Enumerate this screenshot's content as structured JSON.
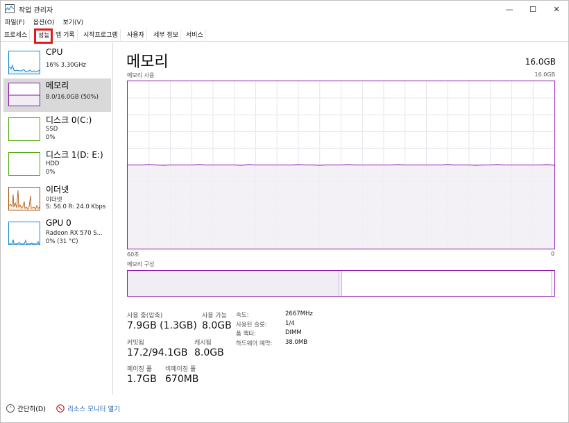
{
  "window": {
    "title": "작업 관리자",
    "minimize_glyph": "—",
    "maximize_glyph": "☐",
    "close_glyph": "✕"
  },
  "menu": [
    "파일(F)",
    "옵션(O)",
    "보기(V)"
  ],
  "tabs": [
    {
      "label": "프로세스",
      "active": false
    },
    {
      "label": "성능",
      "active": true
    },
    {
      "label": "앱 기록",
      "active": false
    },
    {
      "label": "시작프로그램",
      "active": false
    },
    {
      "label": "사용자",
      "active": false
    },
    {
      "label": "세부 정보",
      "active": false
    },
    {
      "label": "서비스",
      "active": false
    }
  ],
  "sidebar": {
    "items": [
      {
        "name": "CPU",
        "line1": "16% 3.30GHz",
        "line2": "",
        "color": "#1784c9",
        "selected": false
      },
      {
        "name": "메모리",
        "line1": "8.0/16.0GB (50%)",
        "line2": "",
        "color": "#8b12ae",
        "selected": true
      },
      {
        "name": "디스크 0(C:)",
        "line1": "SSD",
        "line2": "0%",
        "color": "#4da60c",
        "selected": false
      },
      {
        "name": "디스크 1(D: E:)",
        "line1": "HDD",
        "line2": "0%",
        "color": "#4da60c",
        "selected": false
      },
      {
        "name": "이더넷",
        "line1": "이더넷",
        "line2": "S: 56.0  R: 24.0 Kbps",
        "color": "#a74f01",
        "selected": false
      },
      {
        "name": "GPU 0",
        "line1": "Radeon RX 570 S...",
        "line2": "0% (31 °C)",
        "color": "#1784c9",
        "selected": false
      }
    ]
  },
  "main": {
    "title": "메모리",
    "total": "16.0GB",
    "usage_label": "메모리 사용",
    "usage_max": "16.0GB",
    "time_left": "60초",
    "time_right": "0",
    "composition_label": "메모리 구성",
    "usage_fraction": 0.5,
    "composition": {
      "in_use_fraction": 0.495,
      "modified_fraction": 0.005,
      "standby_fraction": 0.495
    },
    "accent": "#8b12ae",
    "fill": "#f1edf4"
  },
  "stats": {
    "in_use_label": "사용 중(압축)",
    "in_use_value": "7.9GB (1.3GB)",
    "available_label": "사용 가능",
    "available_value": "8.0GB",
    "committed_label": "커밋됨",
    "committed_value": "17.2/94.1GB",
    "cached_label": "캐시됨",
    "cached_value": "8.0GB",
    "paged_label": "페이징 풀",
    "paged_value": "1.7GB",
    "nonpaged_label": "비페이징 풀",
    "nonpaged_value": "670MB"
  },
  "info": [
    {
      "label": "속도:",
      "value": "2667MHz"
    },
    {
      "label": "사용된 슬롯:",
      "value": "1/4"
    },
    {
      "label": "폼 팩터:",
      "value": "DIMM"
    },
    {
      "label": "하드웨어 예약:",
      "value": "38.0MB"
    }
  ],
  "footer": {
    "fewer_details": "간단히(D)",
    "resource_monitor": "리소스 모니터 열기"
  }
}
